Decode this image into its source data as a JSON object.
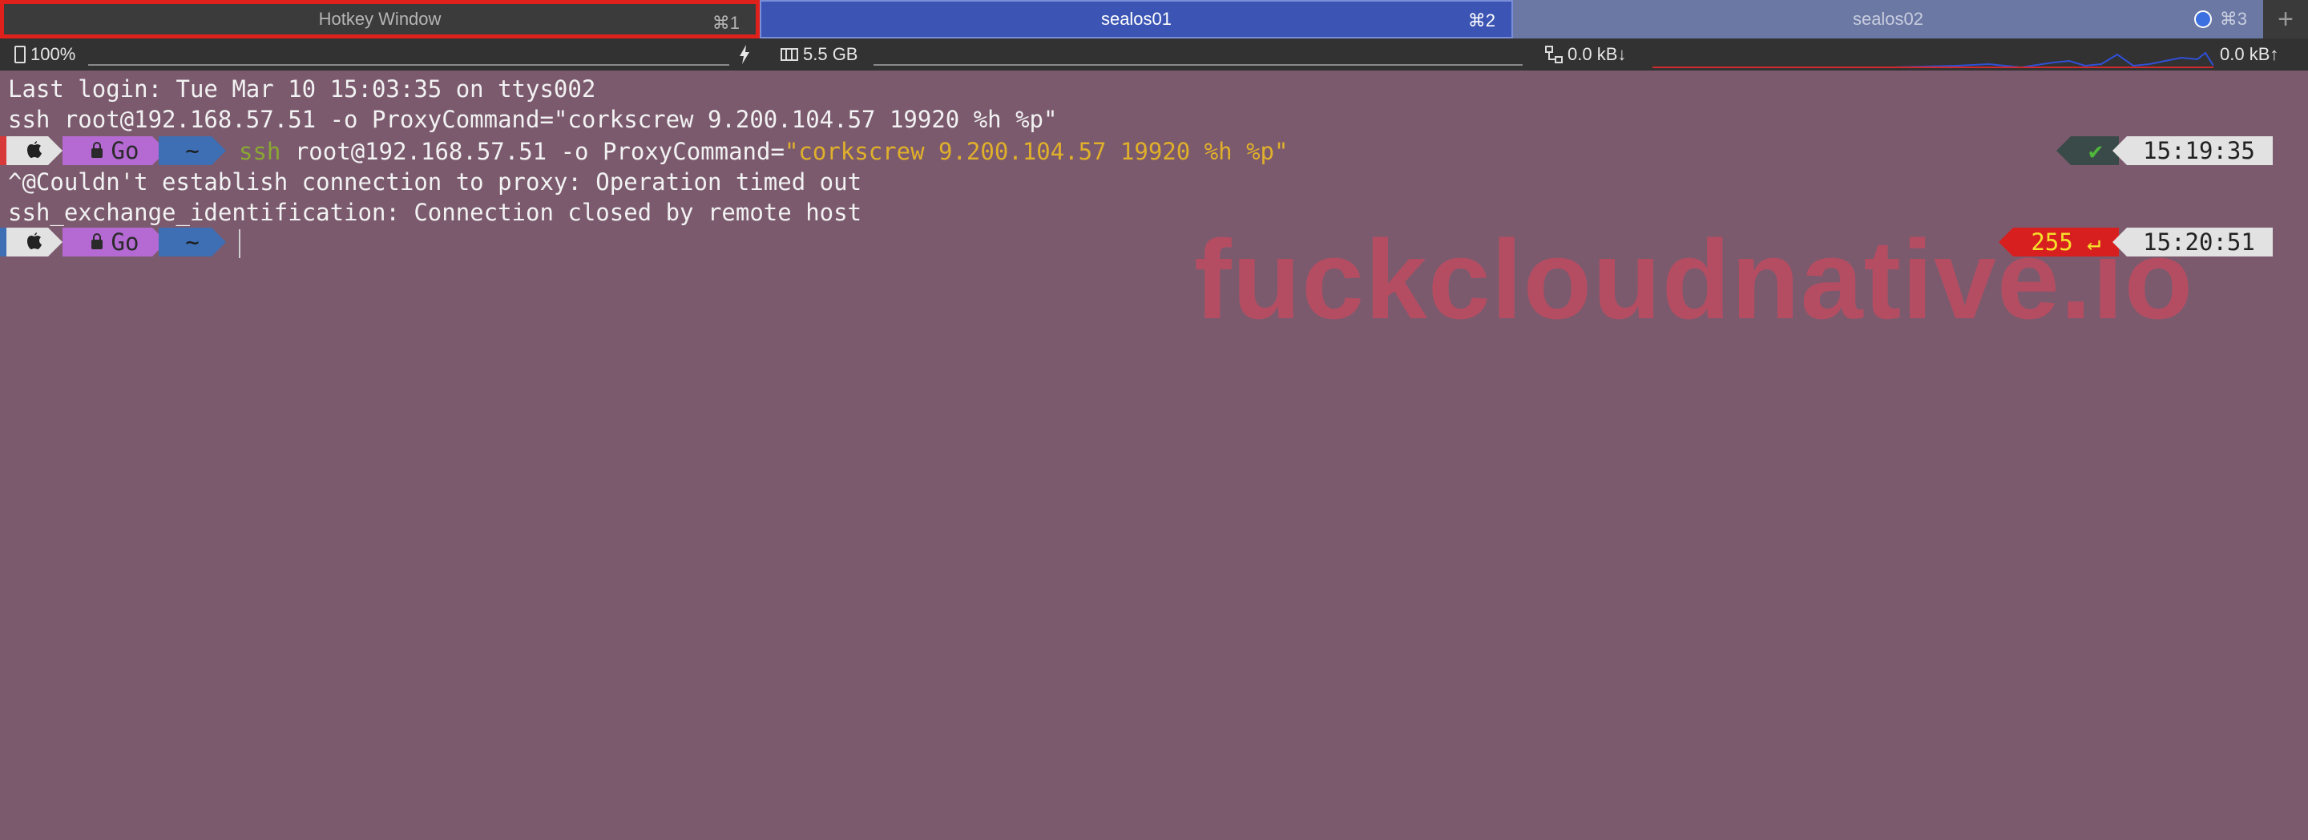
{
  "tabs": [
    {
      "title": "Hotkey Window",
      "shortcut": "⌘1"
    },
    {
      "title": "sealos01",
      "shortcut": "⌘2"
    },
    {
      "title": "sealos02",
      "shortcut": "⌘3"
    }
  ],
  "new_tab": "+",
  "status": {
    "battery": "100%",
    "memory": "5.5 GB",
    "net_down": "0.0 kB↓",
    "net_up": "0.0 kB↑"
  },
  "terminal": {
    "line1": "Last login: Tue Mar 10 15:03:35 on ttys002",
    "line2": "ssh root@192.168.57.51 -o ProxyCommand=\"corkscrew 9.200.104.57 19920 %h %p\"",
    "prompt_dir": "Go",
    "prompt_home": "~",
    "cmd_ssh": "ssh",
    "cmd_args": " root@192.168.57.51 -o ProxyCommand=",
    "cmd_quoted": "\"corkscrew 9.200.104.57 19920 %h %p\"",
    "line4": "^@Couldn't establish connection to proxy: Operation timed out",
    "line5": "ssh_exchange_identification: Connection closed by remote host",
    "ok_mark": "✔",
    "time1": "15:19:35",
    "exit_code": "255 ↵",
    "time2": "15:20:51"
  },
  "watermark": "fuckcloudnative.io",
  "colors": {
    "background": "#7b5a6e",
    "tab_active": "#3c55b4",
    "highlight_border": "#e0201a",
    "cmd_green": "#8aa832",
    "string_yellow": "#e0b02a",
    "error_red": "#d81f1f"
  }
}
